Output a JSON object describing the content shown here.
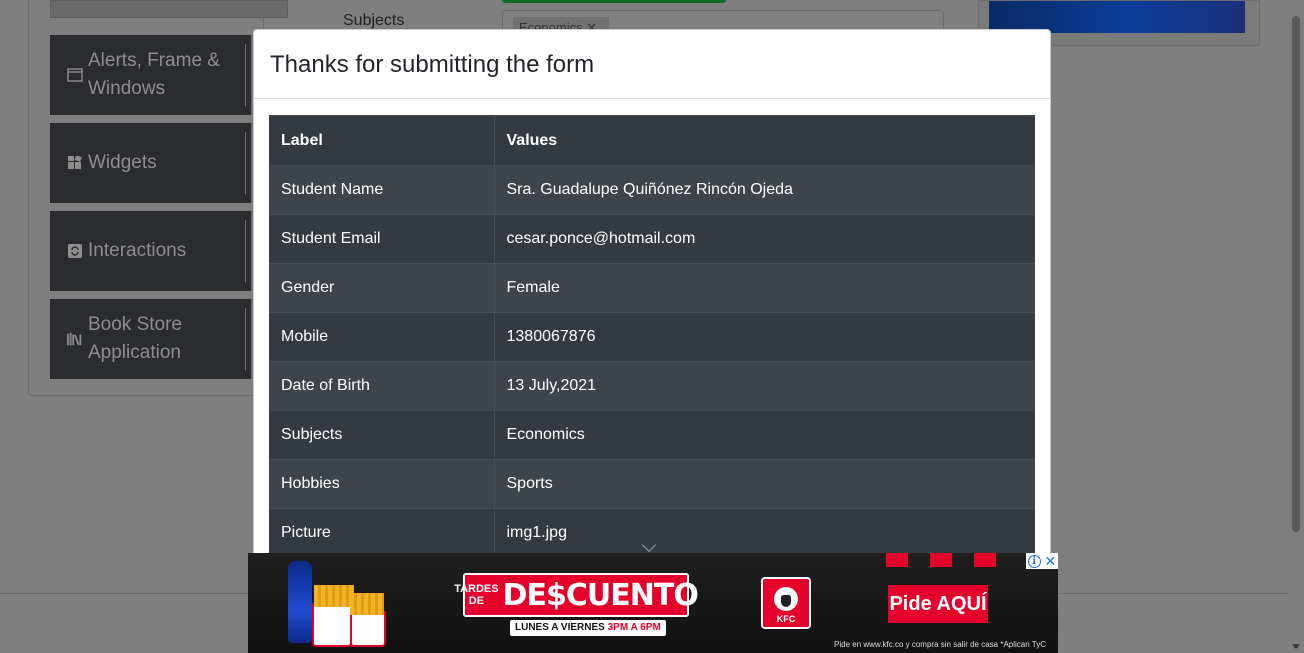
{
  "background": {
    "sidebar_groups": [
      {
        "label": "Alerts, Frame & Windows",
        "icon": "window-icon"
      },
      {
        "label": "Widgets",
        "icon": "widgets-icon"
      },
      {
        "label": "Interactions",
        "icon": "interactions-icon"
      },
      {
        "label": "Book Store Application",
        "icon": "books-icon"
      }
    ],
    "subjects_label": "Subjects",
    "subjects_chip": "Economics"
  },
  "modal": {
    "title": "Thanks for submitting the form",
    "columns": {
      "label": "Label",
      "values": "Values"
    },
    "rows": [
      {
        "label": "Student Name",
        "value": "Sra. Guadalupe Quiñónez Rincón Ojeda"
      },
      {
        "label": "Student Email",
        "value": "cesar.ponce@hotmail.com"
      },
      {
        "label": "Gender",
        "value": "Female"
      },
      {
        "label": "Mobile",
        "value": "1380067876"
      },
      {
        "label": "Date of Birth",
        "value": "13 July,2021"
      },
      {
        "label": "Subjects",
        "value": "Economics"
      },
      {
        "label": "Hobbies",
        "value": "Sports"
      },
      {
        "label": "Picture",
        "value": "img1.jpg"
      }
    ]
  },
  "ad": {
    "headline_small_1": "TARDES",
    "headline_small_2": "DE",
    "headline_big": "DE$CUENTO",
    "sub_text": "LUNES A VIERNES",
    "sub_highlight": "3PM A 6PM",
    "brand": "KFC",
    "cta": "Pide AQUÍ",
    "fine_print": "Pide en www.kfc.co y compra sin salir de casa *Aplican TyC",
    "info_glyph": "i",
    "close_glyph": "✕"
  },
  "colors": {
    "table_dark": "#343a40",
    "table_stripe": "#3e444a",
    "ad_red": "#e4002b",
    "overlay_gray": "#808080"
  }
}
